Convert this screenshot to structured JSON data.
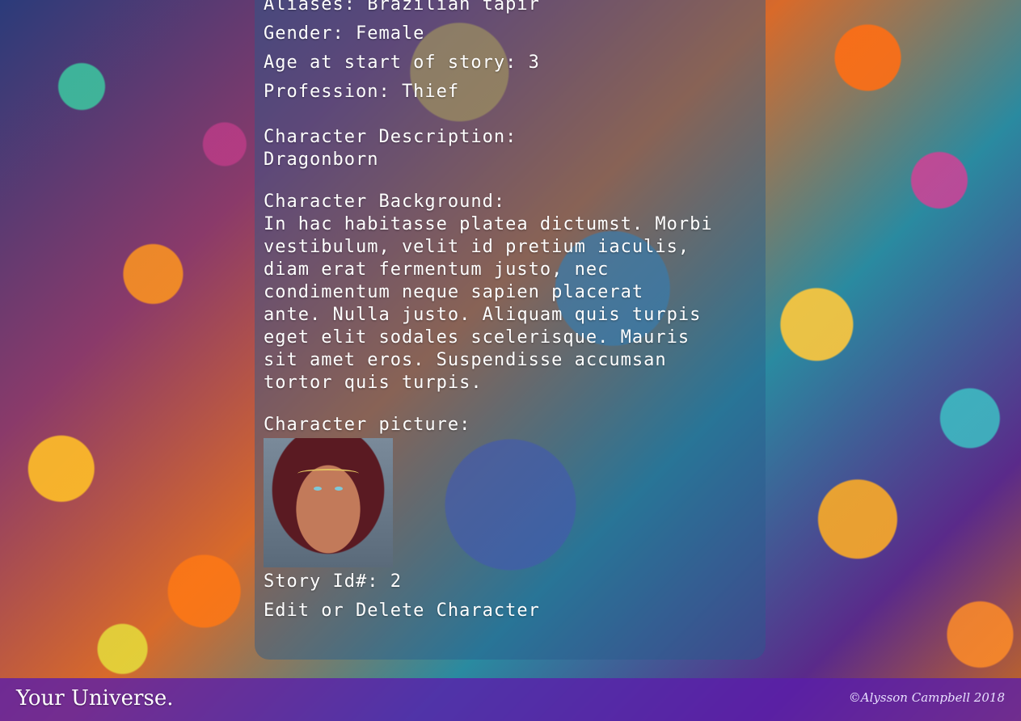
{
  "character": {
    "aliases": "Aliases: Brazilian tapir",
    "gender": "Gender: Female",
    "age": "Age at start of story: 3",
    "profession": "Profession: Thief",
    "description_label": "Character Description:",
    "description": "Dragonborn",
    "background_label": "Character Background:",
    "background": "In hac habitasse platea dictumst. Morbi\nvestibulum, velit id pretium iaculis,\ndiam erat fermentum justo, nec\ncondimentum neque sapien placerat\nante. Nulla justo. Aliquam quis turpis\neget elit sodales scelerisque. Mauris\nsit amet eros. Suspendisse accumsan\ntortor quis turpis.",
    "picture_label": "Character picture:",
    "story_id": "Story Id#: 2",
    "edit_link": "Edit or Delete Character"
  },
  "footer": {
    "brand": "Your Universe.",
    "copyright": "©Alysson Campbell 2018"
  }
}
